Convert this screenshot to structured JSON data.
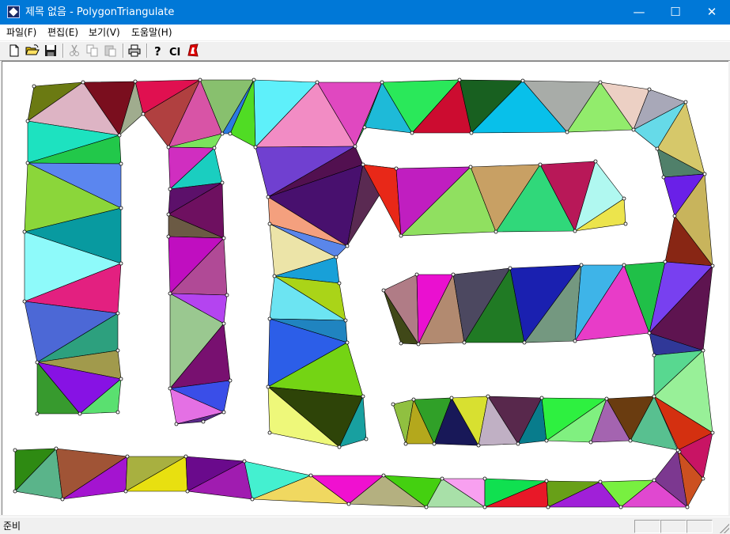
{
  "window": {
    "title": "제목 없음 - PolygonTriangulate",
    "app_icon": "polygon-app-icon",
    "minimize_glyph": "—",
    "maximize_glyph": "☐",
    "close_glyph": "✕"
  },
  "menu": [
    {
      "label": "파일(F)"
    },
    {
      "label": "편집(E)"
    },
    {
      "label": "보기(V)"
    },
    {
      "label": "도움말(H)"
    }
  ],
  "toolbar": {
    "buttons": [
      {
        "icon": "new-document-icon",
        "enabled": true
      },
      {
        "icon": "open-folder-icon",
        "enabled": true
      },
      {
        "icon": "save-icon",
        "enabled": true
      },
      {
        "icon": "cut-icon",
        "enabled": false
      },
      {
        "icon": "copy-icon",
        "enabled": false
      },
      {
        "icon": "paste-icon",
        "enabled": false
      },
      {
        "icon": "print-icon",
        "enabled": true
      },
      {
        "icon": "help-icon",
        "enabled": true
      },
      {
        "icon": "clear-icon",
        "label": "CI",
        "enabled": true
      },
      {
        "icon": "polygon-icon",
        "enabled": true
      }
    ]
  },
  "status": {
    "text": "준비"
  },
  "drawing": {
    "vertex_color": "#000000",
    "edge_color": "#000000"
  }
}
